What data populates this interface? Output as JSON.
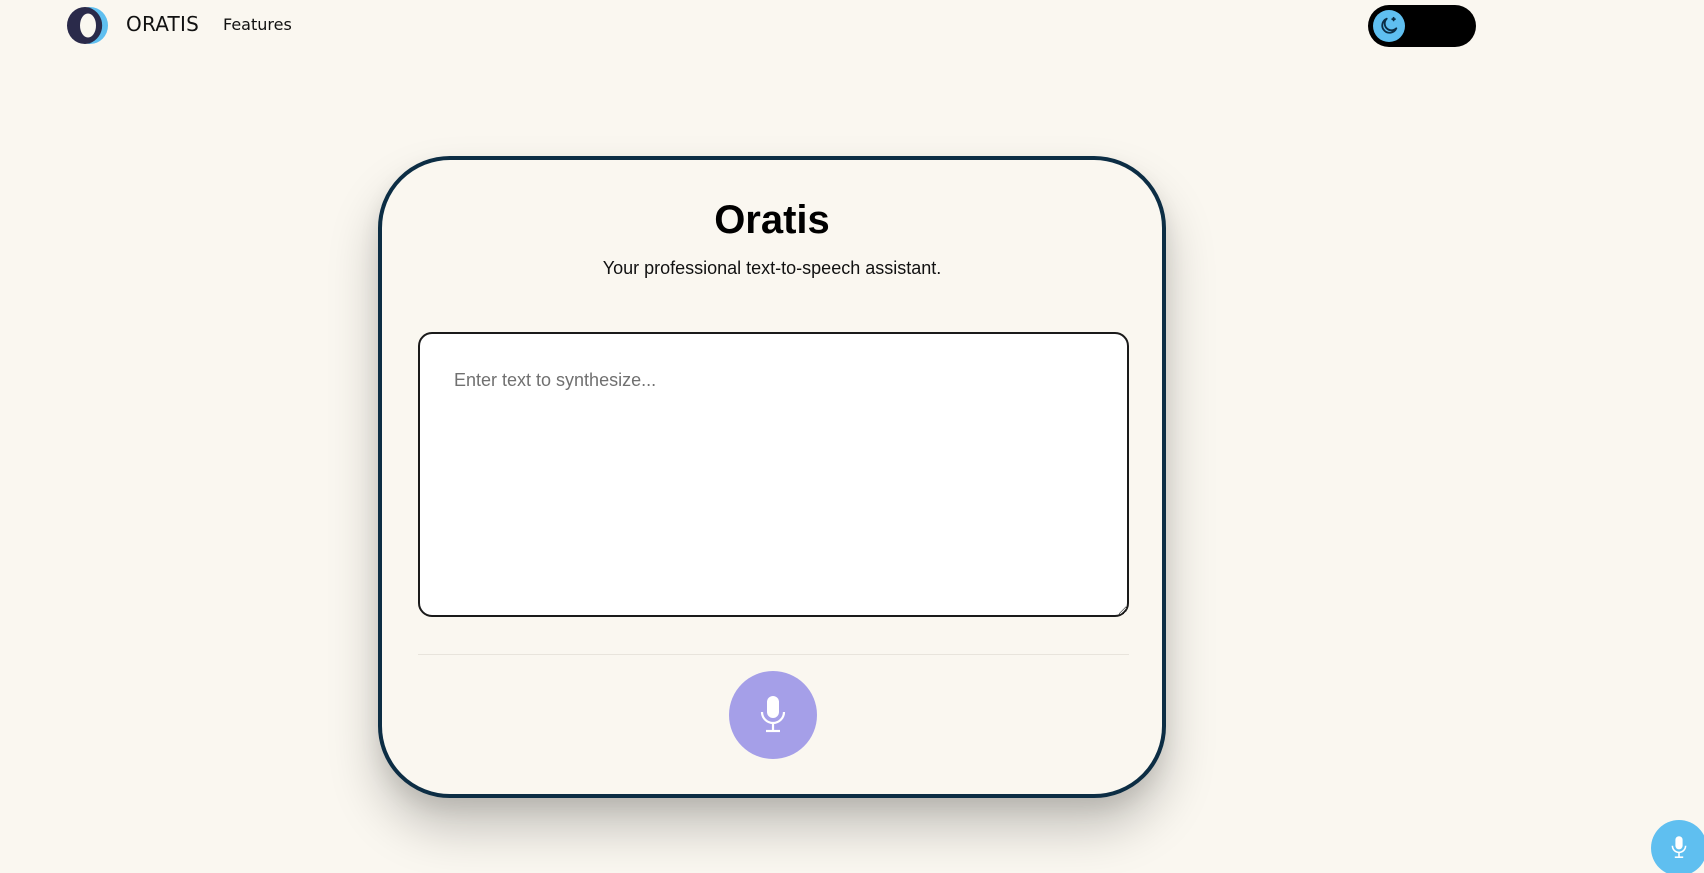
{
  "header": {
    "brand": "ORATIS",
    "nav": [
      {
        "label": "Features"
      }
    ],
    "theme_toggle": {
      "icon": "moon-icon",
      "state": "dark-mode-off"
    }
  },
  "main": {
    "title": "Oratis",
    "subtitle": "Your professional text-to-speech assistant.",
    "input": {
      "placeholder": "Enter text to synthesize...",
      "value": ""
    },
    "mic_button": {
      "icon": "microphone-icon"
    }
  },
  "fab": {
    "icon": "microphone-icon"
  },
  "colors": {
    "background": "#faf7f0",
    "card_border": "#0c2d44",
    "accent_blue": "#5fbff0",
    "mic_purple": "#a59fe8",
    "logo_dark": "#2a2a4a"
  }
}
